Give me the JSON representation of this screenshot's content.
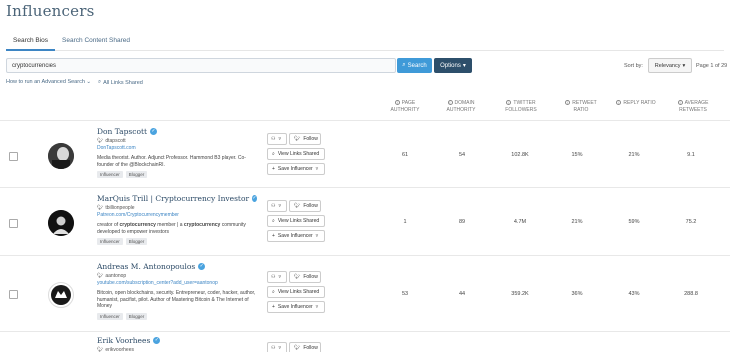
{
  "page": {
    "title": "Influencers"
  },
  "tabs": [
    {
      "label": "Search Bios"
    },
    {
      "label": "Search Content Shared"
    }
  ],
  "search": {
    "query": "cryptocurrencies",
    "button": "Search",
    "options": "Options"
  },
  "sort": {
    "label": "Sort by:",
    "value": "Relevancy",
    "pagination": "Page 1 of 29"
  },
  "links": {
    "advanced": "How to run an Advanced Search",
    "all_links": "All Links Shared"
  },
  "columns": [
    {
      "label": "PAGE AUTHORITY"
    },
    {
      "label": "DOMAIN AUTHORITY"
    },
    {
      "label": "TWITTER FOLLOWERS"
    },
    {
      "label": "RETWEET RATIO"
    },
    {
      "label": "REPLY RATIO"
    },
    {
      "label": "AVERAGE RETWEETS"
    }
  ],
  "actions": {
    "follow": "Follow",
    "view_links": "View Links Shared",
    "save": "Save Influencer"
  },
  "influencers": [
    {
      "name": "Don Tapscott",
      "handle": "dtapscott",
      "site": "DonTapscott.com",
      "bio": "Media theorist. Author. Adjunct Professor. Hammond B3 player. Co-founder of the @BlockchainRI.",
      "tags": [
        "Influencer",
        "Blogger"
      ],
      "page_authority": "61",
      "domain_authority": "54",
      "followers": "102.8K",
      "retweet_ratio": "15%",
      "reply_ratio": "21%",
      "avg_retweets": "9.1"
    },
    {
      "name": "MarQuis Trill | Cryptocurrency Investor",
      "handle": "tbillionpeople",
      "site": "Patreon.com/Cryptocurrencymember",
      "bio_pre": "creator of ",
      "bio_b1": "cryptocurrency",
      "bio_mid": " member | a ",
      "bio_b2": "cryptocurrency",
      "bio_post": " community developed to empower investors",
      "tags": [
        "Influencer",
        "Blogger"
      ],
      "page_authority": "1",
      "domain_authority": "89",
      "followers": "4.7M",
      "retweet_ratio": "21%",
      "reply_ratio": "59%",
      "avg_retweets": "75.2"
    },
    {
      "name": "Andreas M. Antonopoulos",
      "handle": "aantonop",
      "site": "youtube.com/subscription_center?add_user=aantonop",
      "bio": "Bitcoin, open blockchains, security. Entrepreneur, coder, hacker, author, humanist, pacifist, pilot. Author of Mastering Bitcoin & The Internet of Money",
      "tags": [
        "Influencer",
        "Blogger"
      ],
      "page_authority": "53",
      "domain_authority": "44",
      "followers": "359.2K",
      "retweet_ratio": "36%",
      "reply_ratio": "43%",
      "avg_retweets": "288.8"
    },
    {
      "name": "Erik Voorhees",
      "handle": "erikvoorhees"
    }
  ],
  "colors": {
    "accent": "#3f9ad8",
    "options": "#2d4f6b",
    "title": "#4b6478",
    "name": "#2c4a66"
  }
}
